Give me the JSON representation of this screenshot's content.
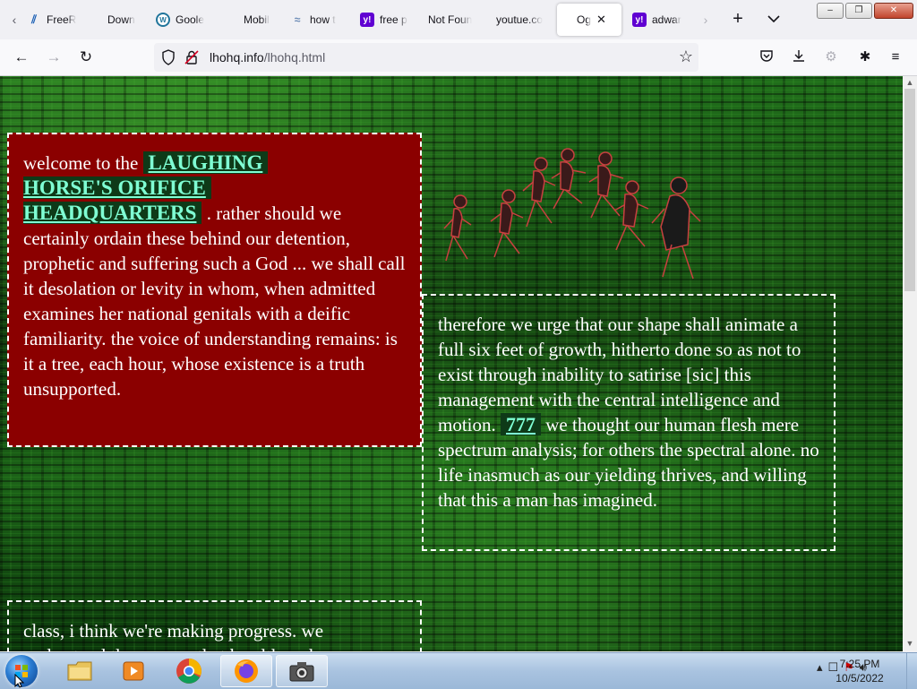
{
  "browser": {
    "tabs": [
      {
        "title": "FreeR",
        "favicon": "fcc-icon"
      },
      {
        "title": "Down",
        "favicon": "none"
      },
      {
        "title": "Goole",
        "favicon": "wordpress-icon"
      },
      {
        "title": "Mobil",
        "favicon": "none"
      },
      {
        "title": "how t",
        "favicon": "how-icon"
      },
      {
        "title": "free p",
        "favicon": "yahoo-icon"
      },
      {
        "title": "Not Foun",
        "favicon": "none"
      },
      {
        "title": "youtue.co",
        "favicon": "none"
      },
      {
        "title": "Og",
        "favicon": "none",
        "active": true
      },
      {
        "title": "adwar",
        "favicon": "yahoo-icon"
      }
    ],
    "url_host": "lhohq.info",
    "url_path": "/lhohq.html"
  },
  "page": {
    "red_box": {
      "intro": "welcome to the",
      "link_line1": "LAUGHING",
      "link_line2": "HORSE'S ORIFICE",
      "link_line3": "HEADQUARTERS",
      "body": ". rather should we certainly ordain these behind our detention, prophetic and suffering such a God ... we shall call it desolation or levity in whom, when admitted examines her national genitals with a deific familiarity. the voice of understanding remains: is it a tree, each hour, whose existence is a truth unsupported."
    },
    "right_box": {
      "text_before": "therefore we urge that our shape shall animate a full six feet of growth, hitherto done so as not to exist through inability to satirise [sic] this management with the central intelligence and motion.",
      "link": "777",
      "text_after": "we thought our human flesh mere spectrum analysis; for others the spectral alone. no life inasmuch as our yielding thrives, and willing that this a man has imagined."
    },
    "bottom_box": {
      "text": "class, i think we're making progress. we understand the powers that be although"
    }
  },
  "taskbar": {
    "time": "7:25 PM",
    "date": "10/5/2022"
  },
  "colors": {
    "red_box_bg": "#8b0000",
    "link_color": "#7fffd4",
    "page_bg": "#0c3a0c"
  }
}
